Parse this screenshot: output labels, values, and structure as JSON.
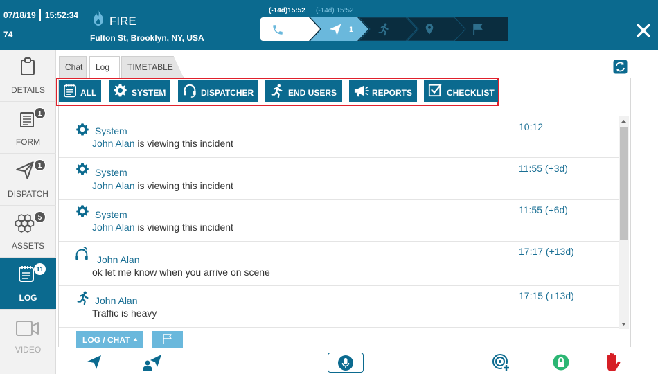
{
  "header": {
    "date": "07/18/19",
    "time": "15:52:34",
    "incident_number": "74",
    "incident_type": "FIRE",
    "address": "Fulton St, Brooklyn, NY, USA",
    "timestamp_active": "(-14d)15:52",
    "timestamp_secondary": "(-14d) 15:52",
    "dispatch_count": "1",
    "icons": [
      "fire-icon",
      "phone-icon",
      "send-icon",
      "runner-icon",
      "location-pin-icon",
      "flag-icon",
      "close-icon"
    ]
  },
  "nav": {
    "items": [
      {
        "label": "DETAILS",
        "icon": "clipboard-icon",
        "badge": ""
      },
      {
        "label": "FORM",
        "icon": "form-icon",
        "badge": "1"
      },
      {
        "label": "DISPATCH",
        "icon": "send-icon",
        "badge": "1"
      },
      {
        "label": "ASSETS",
        "icon": "hexagons-icon",
        "badge": "5"
      },
      {
        "label": "LOG",
        "icon": "log-icon",
        "badge": "11"
      },
      {
        "label": "VIDEO",
        "icon": "video-camera-icon",
        "badge": ""
      }
    ]
  },
  "tabs": {
    "chat": "Chat",
    "log": "Log",
    "timetable": "TIMETABLE"
  },
  "filters": {
    "all": "ALL",
    "system": "SYSTEM",
    "dispatcher": "DISPATCHER",
    "end_users": "END USERS",
    "reports": "REPORTS",
    "checklist": "CHECKLIST"
  },
  "log": {
    "entries": [
      {
        "source": "System",
        "who": "John Alan",
        "message": " is viewing this incident",
        "time": "10:12",
        "icon": "gear-icon"
      },
      {
        "source": "System",
        "who": "John Alan",
        "message": " is viewing this incident",
        "time": "11:55 (+3d)",
        "icon": "gear-icon"
      },
      {
        "source": "System",
        "who": "John Alan",
        "message": " is viewing this incident",
        "time": "11:55 (+6d)",
        "icon": "gear-icon"
      },
      {
        "source": "John Alan",
        "who": "",
        "message": "ok let me know when you arrive on scene",
        "time": "17:17 (+13d)",
        "icon": "headset-icon"
      },
      {
        "source": "John Alan",
        "who": "",
        "message": "Traffic is heavy",
        "time": "17:15 (+13d)",
        "icon": "runner-icon"
      }
    ]
  },
  "bottom": {
    "log_chat_label": "LOG / CHAT",
    "icons": [
      "send-icon",
      "send-user-icon",
      "microphone-icon",
      "target-add-icon",
      "lock-icon",
      "stop-hand-icon"
    ]
  },
  "colors": {
    "primary": "#0b6a8f",
    "light_blue": "#6ab8dc",
    "highlight_red": "#e0202c",
    "lock_green": "#2bb673",
    "stop_red": "#d61f26"
  }
}
